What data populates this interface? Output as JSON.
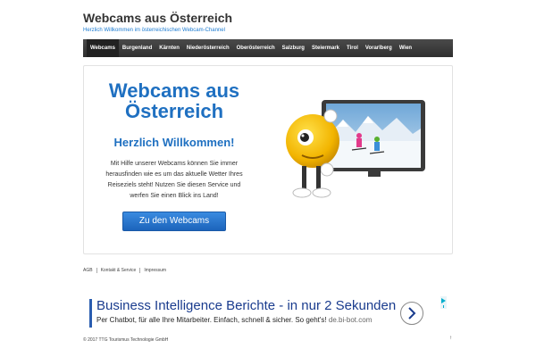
{
  "header": {
    "title": "Webcams aus Österreich",
    "tagline": "Herzlich Willkommen im österreichischen Webcam-Channel"
  },
  "nav": {
    "items": [
      "Webcams",
      "Burgenland",
      "Kärnten",
      "Niederösterreich",
      "Oberösterreich",
      "Salzburg",
      "Steiermark",
      "Tirol",
      "Vorarlberg",
      "Wien"
    ]
  },
  "hero": {
    "heading": "Webcams aus Österreich",
    "subheading": "Herzlich Willkommen!",
    "text": "Mit Hilfe unserer Webcams können Sie immer herausfinden wie es um das aktuelle Wetter Ihres Reiseziels steht! Nutzen Sie diesen Service und werfen Sie einen Blick ins Land!",
    "button": "Zu den Webcams"
  },
  "footer": {
    "links": [
      "AGB",
      "Kontakt & Service",
      "Impressum"
    ],
    "copyright": "© 2017 TTG Tourismus Technologie GmbH",
    "to_top": "↑"
  },
  "ad": {
    "title": "Business Intelligence Berichte - in nur 2 Sekunden",
    "text": "Per Chatbot, für alle Ihre Mitarbeiter. Einfach, schnell & sicher. So geht's!",
    "url": "de.bi-bot.com",
    "arrow_icon": "chevron-right-icon"
  },
  "colors": {
    "accent": "#1f70c1",
    "nav_bg": "#3a3a3a",
    "button": "#2a79d2"
  }
}
